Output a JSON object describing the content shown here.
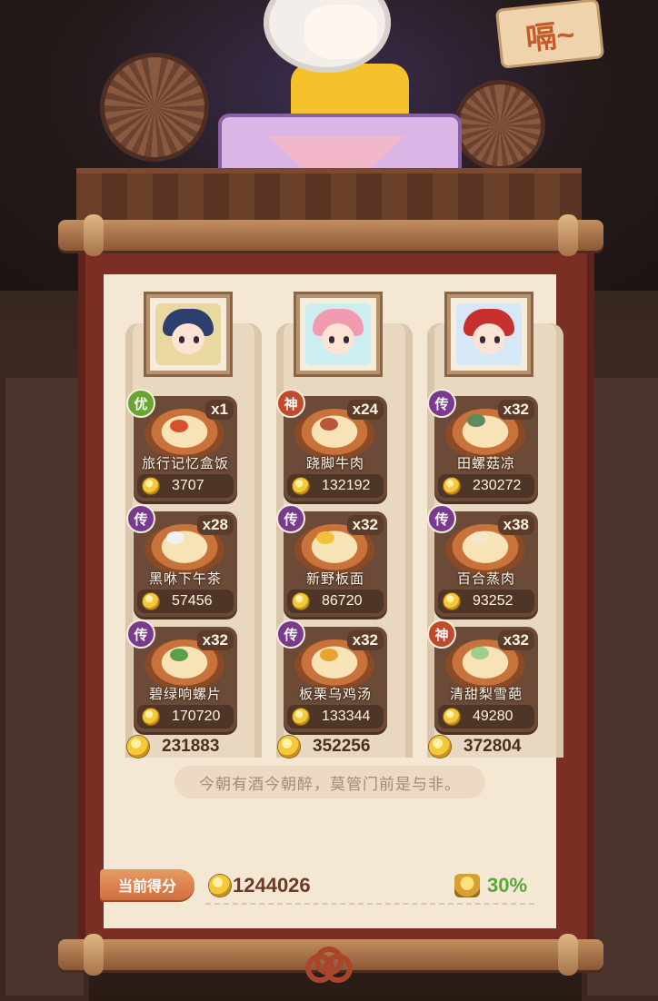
{
  "header": {
    "sign_text": "嗝~"
  },
  "columns": [
    {
      "portrait_colors": {
        "hair": "#2e3f6e",
        "bg": "#e9d9a0"
      },
      "total": "231883",
      "dishes": [
        {
          "name": "旅行记忆盒饭",
          "count": "x1",
          "price": "3707",
          "badge": "优",
          "badge_color": "#6ba531"
        },
        {
          "name": "黑咻下午茶",
          "count": "x28",
          "price": "57456",
          "badge": "传",
          "badge_color": "#7a3b8f"
        },
        {
          "name": "碧绿响螺片",
          "count": "x32",
          "price": "170720",
          "badge": "传",
          "badge_color": "#7a3b8f"
        }
      ]
    },
    {
      "portrait_colors": {
        "hair": "#f29ab0",
        "bg": "#cdeef0"
      },
      "total": "352256",
      "dishes": [
        {
          "name": "跷脚牛肉",
          "count": "x24",
          "price": "132192",
          "badge": "神",
          "badge_color": "#c04a2b"
        },
        {
          "name": "新野板面",
          "count": "x32",
          "price": "86720",
          "badge": "传",
          "badge_color": "#7a3b8f"
        },
        {
          "name": "板栗乌鸡汤",
          "count": "x32",
          "price": "133344",
          "badge": "传",
          "badge_color": "#7a3b8f"
        }
      ]
    },
    {
      "portrait_colors": {
        "hair": "#c8302f",
        "bg": "#d6e8f6"
      },
      "total": "372804",
      "dishes": [
        {
          "name": "田螺菇凉",
          "count": "x32",
          "price": "230272",
          "badge": "传",
          "badge_color": "#7a3b8f"
        },
        {
          "name": "百合蒸肉",
          "count": "x38",
          "price": "93252",
          "badge": "传",
          "badge_color": "#7a3b8f"
        },
        {
          "name": "清甜梨雪葩",
          "count": "x32",
          "price": "49280",
          "badge": "神",
          "badge_color": "#c04a2b"
        }
      ]
    }
  ],
  "motto": "今朝有酒今朝醉，莫管门前是与非。",
  "score": {
    "label": "当前得分",
    "value": "1244026",
    "bonus": "30%"
  }
}
